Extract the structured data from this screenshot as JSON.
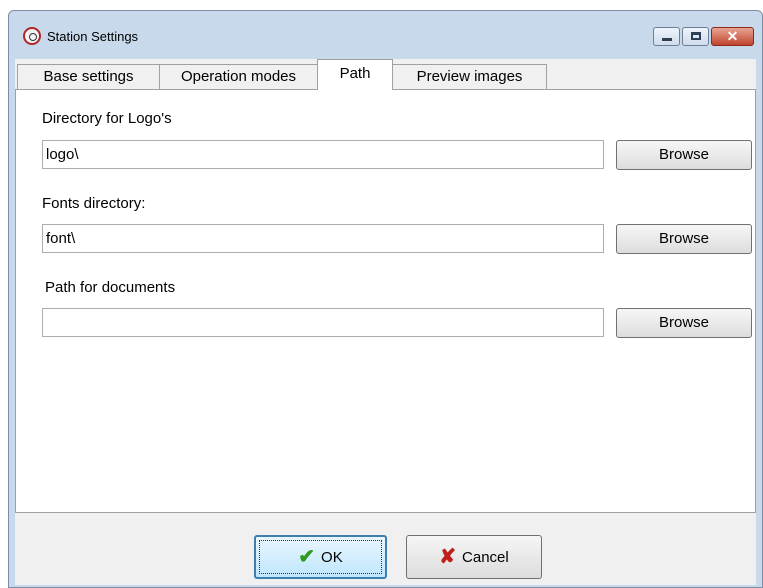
{
  "window": {
    "title": "Station Settings"
  },
  "tabs": [
    {
      "label": "Base settings",
      "active": false
    },
    {
      "label": "Operation modes",
      "active": false
    },
    {
      "label": "Path",
      "active": true
    },
    {
      "label": "Preview images",
      "active": false
    }
  ],
  "path_tab": {
    "logo_dir": {
      "label": "Directory for Logo's",
      "value": "logo\\",
      "browse_label": "Browse"
    },
    "fonts_dir": {
      "label": "Fonts directory:",
      "value": "font\\",
      "browse_label": "Browse"
    },
    "docs_path": {
      "label": "Path for documents",
      "value": "",
      "browse_label": "Browse"
    }
  },
  "footer": {
    "ok_label": "OK",
    "cancel_label": "Cancel"
  },
  "icons": {
    "app": "app-icon",
    "minimize": "minimize-icon",
    "maximize": "maximize-icon",
    "close": "close-icon",
    "ok": "checkmark-icon",
    "cancel": "cross-icon"
  },
  "colors": {
    "titlebar": "#c9d9ec",
    "close_button": "#c0452c",
    "ok_check": "#2e9a1e",
    "cancel_x": "#c0201c"
  }
}
